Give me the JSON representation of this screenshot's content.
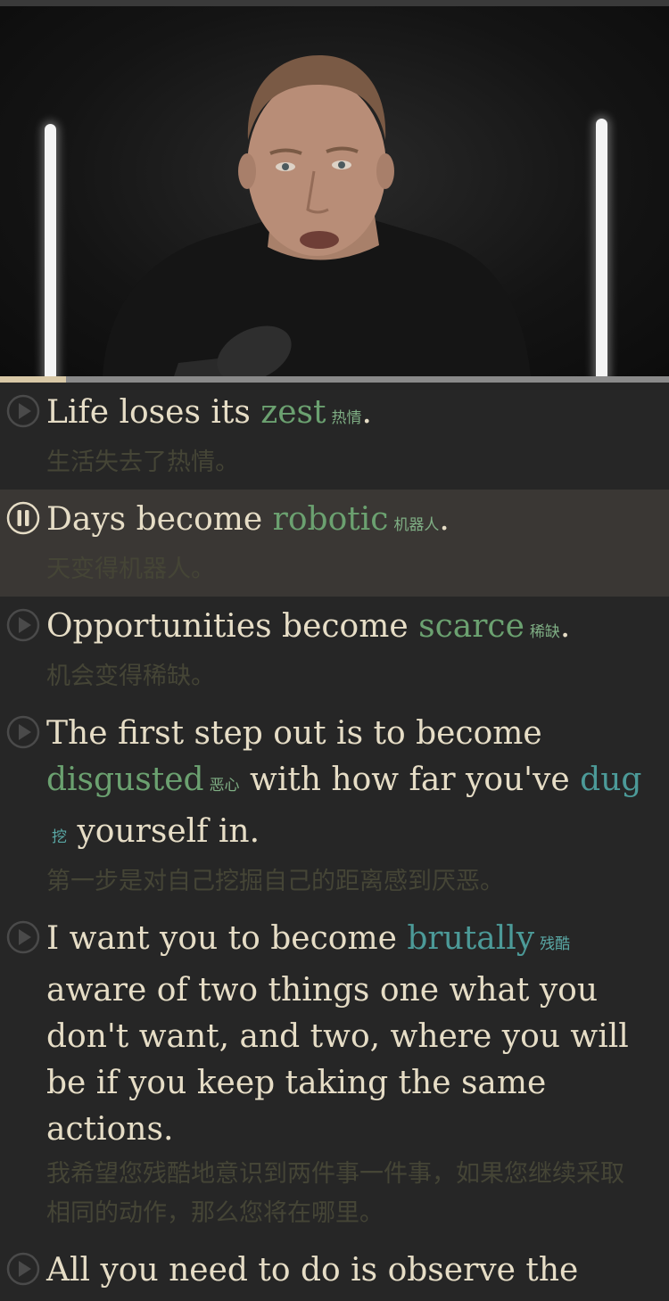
{
  "progress": 0.099,
  "subtitles": [
    {
      "en_before": "Life loses its ",
      "keyword": "zest",
      "gloss": "热情",
      "en_after": ".",
      "zh": "生活失去了热情。",
      "state": "play-icon"
    },
    {
      "en_before": "Days become ",
      "keyword": "robotic",
      "gloss": "机器人",
      "en_after": ".",
      "zh": "天变得机器人。",
      "state": "pause-icon"
    },
    {
      "en_before": "Opportunities become ",
      "keyword": "scarce",
      "gloss": "稀缺",
      "en_after": ".",
      "zh": "机会变得稀缺。",
      "state": "play-icon"
    },
    {
      "en_before": "The first step out is to become ",
      "keyword": "disgusted",
      "gloss": "恶心",
      "en_mid": " with how far you've ",
      "keyword2": "dug",
      "gloss2": "挖",
      "en_after": " yourself in.",
      "zh": "第一步是对自己挖掘自己的距离感到厌恶。",
      "state": "play-icon"
    },
    {
      "en_before": "I want you to become ",
      "keyword": "brutally",
      "gloss": "残酷",
      "en_after": " aware of two things one what you don't want, and two, where you will be if you keep taking the same actions.",
      "zh": "我希望您残酷地意识到两件事一件事，如果您继续采取相同的动作，那么您将在哪里。",
      "state": "play-icon"
    },
    {
      "en_before": "All you need to do is observe the",
      "state": "play-icon"
    }
  ],
  "colors": {
    "background": "#262626",
    "keyword_green": "#6ba170",
    "keyword_teal": "#4c9a98",
    "text": "#e6ddc6",
    "translation": "#454536",
    "active_row": "#3a3734"
  }
}
